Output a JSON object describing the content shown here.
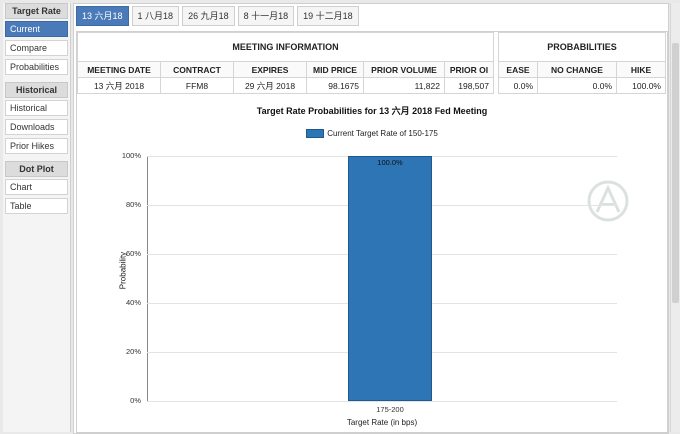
{
  "sidebar": {
    "groups": [
      {
        "header": "Target Rate",
        "items": [
          "Current",
          "Compare",
          "Probabilities"
        ]
      },
      {
        "header": "Historical",
        "items": [
          "Historical",
          "Downloads",
          "Prior Hikes"
        ]
      },
      {
        "header": "Dot Plot",
        "items": [
          "Chart",
          "Table"
        ]
      }
    ]
  },
  "tabs": [
    "13 六月18",
    "1 八月18",
    "26 九月18",
    "8 十一月18",
    "19 十二月18"
  ],
  "meeting_info": {
    "section_title": "MEETING INFORMATION",
    "headers": [
      "MEETING DATE",
      "CONTRACT",
      "EXPIRES",
      "MID PRICE",
      "PRIOR VOLUME",
      "PRIOR OI"
    ],
    "row": [
      "13 六月 2018",
      "FFM8",
      "29 六月 2018",
      "98.1675",
      "11,822",
      "198,507"
    ]
  },
  "probabilities": {
    "section_title": "PROBABILITIES",
    "headers": [
      "EASE",
      "NO CHANGE",
      "HIKE"
    ],
    "row": [
      "0.0%",
      "0.0%",
      "100.0%"
    ]
  },
  "chart_data": {
    "type": "bar",
    "title": "Target Rate Probabilities for 13 六月 2018  Fed Meeting",
    "legend": "Current Target Rate of 150-175",
    "categories": [
      "175-200"
    ],
    "values": [
      100.0
    ],
    "value_labels": [
      "100.0%"
    ],
    "ylabel": "Probability",
    "xlabel": "Target Rate (in bps)",
    "ylim": [
      0,
      100
    ],
    "yticks": [
      "0%",
      "20%",
      "40%",
      "60%",
      "80%",
      "100%"
    ],
    "color": "#2e75b6",
    "grid": true
  }
}
